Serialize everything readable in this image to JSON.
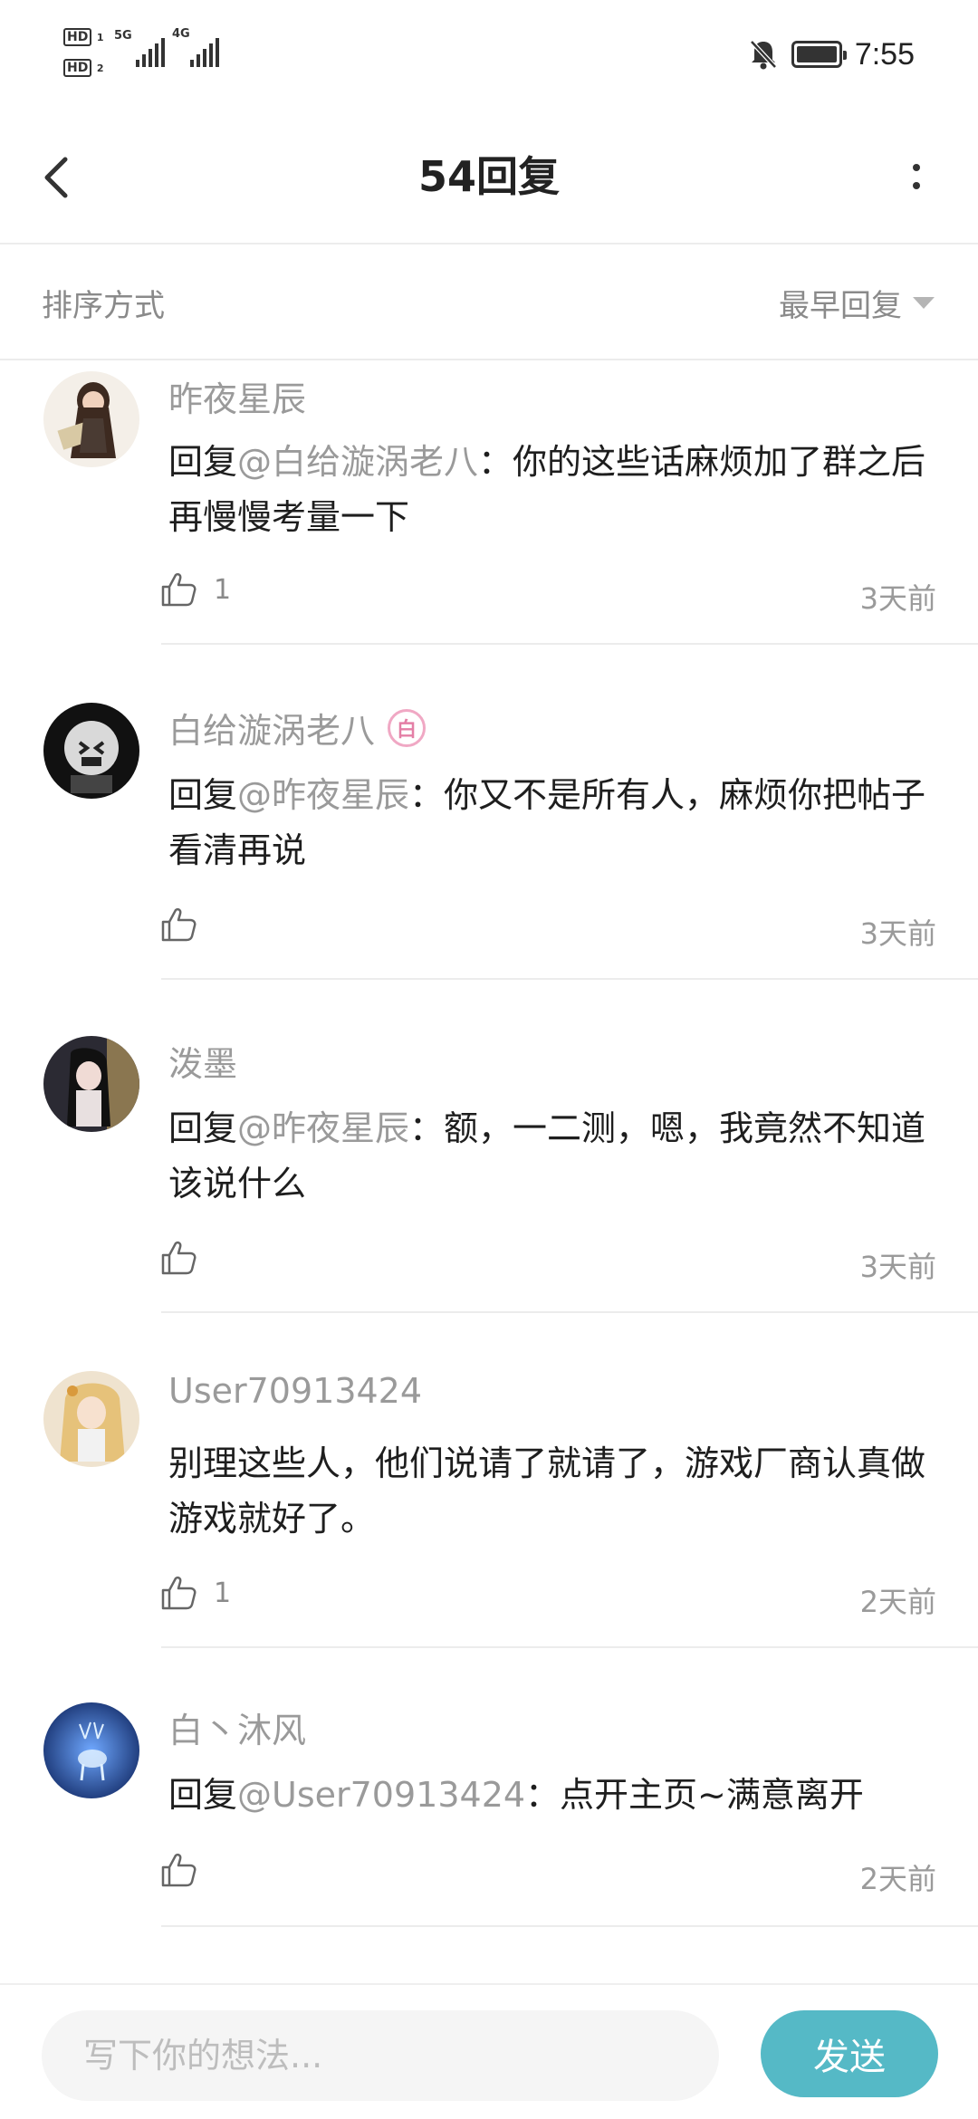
{
  "status_bar": {
    "hd1": "HD",
    "hd1_sub": "1",
    "hd2": "HD",
    "hd2_sub": "2",
    "net1": "5G",
    "net2": "4G",
    "time": "7:55"
  },
  "header": {
    "title": "54回复"
  },
  "sort": {
    "label": "排序方式",
    "value": "最早回复"
  },
  "comments": [
    {
      "username": "昨夜星辰",
      "reply_prefix": "回复",
      "mention": "@白给漩涡老八",
      "text": "：你的这些话麻烦加了群之后再慢慢考量一下",
      "likes": "1",
      "time": "3天前",
      "avatar_color": "#5a3d2e"
    },
    {
      "username": "白给漩涡老八",
      "badge": "白",
      "reply_prefix": "回复",
      "mention": "@昨夜星辰",
      "text": "：你又不是所有人，麻烦你把帖子看清再说",
      "likes": "",
      "time": "3天前",
      "avatar_color": "#222222"
    },
    {
      "username": "泼墨",
      "reply_prefix": "回复",
      "mention": "@昨夜星辰",
      "text": "：额，一二测，嗯，我竟然不知道该说什么",
      "likes": "",
      "time": "3天前",
      "avatar_color": "#2b2a33"
    },
    {
      "username": "User70913424",
      "reply_prefix": "",
      "mention": "",
      "text": "别理这些人，他们说请了就请了，游戏厂商认真做游戏就好了。",
      "likes": "1",
      "time": "2天前",
      "avatar_color": "#d8b478"
    },
    {
      "username": "白丶沐风",
      "reply_prefix": "回复",
      "mention": "@User70913424",
      "text": "：点开主页~满意离开",
      "likes": "",
      "time": "2天前",
      "avatar_color": "#1f3f8a"
    }
  ],
  "input": {
    "placeholder": "写下你的想法..."
  },
  "send_label": "发送",
  "colors": {
    "accent": "#55b9c6",
    "muted": "#9a9a9a",
    "text": "#1e1e1e"
  }
}
